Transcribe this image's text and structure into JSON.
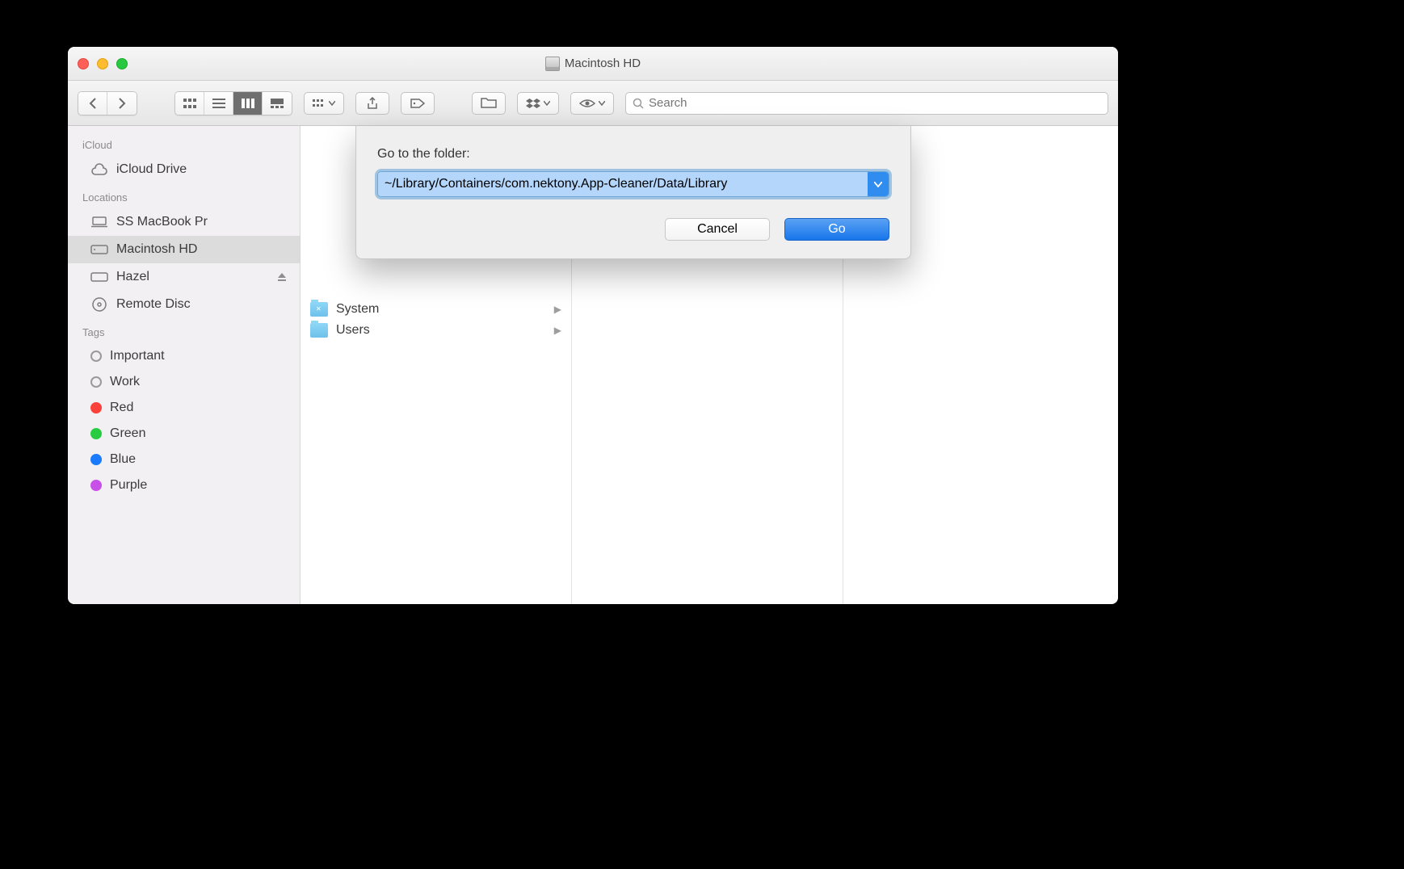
{
  "window": {
    "title": "Macintosh HD"
  },
  "toolbar": {
    "search_placeholder": "Search"
  },
  "sidebar": {
    "sections": {
      "icloud": {
        "title": "iCloud",
        "items": [
          "iCloud Drive"
        ]
      },
      "locations": {
        "title": "Locations",
        "items": [
          "SS MacBook Pr",
          "Macintosh HD",
          "Hazel",
          "Remote Disc"
        ]
      },
      "tags": {
        "title": "Tags",
        "items": [
          {
            "label": "Important",
            "color": null
          },
          {
            "label": "Work",
            "color": null
          },
          {
            "label": "Red",
            "color": "#fc413b"
          },
          {
            "label": "Green",
            "color": "#29cc41"
          },
          {
            "label": "Blue",
            "color": "#1a7bff"
          },
          {
            "label": "Purple",
            "color": "#c750e8"
          }
        ]
      }
    },
    "selected": "Macintosh HD"
  },
  "columns": [
    {
      "rows": [
        {
          "label": "System",
          "type": "system"
        },
        {
          "label": "Users",
          "type": "folder"
        }
      ]
    }
  ],
  "dialog": {
    "label": "Go to the folder:",
    "path": "~/Library/Containers/com.nektony.App-Cleaner/Data/Library",
    "cancel": "Cancel",
    "go": "Go"
  }
}
